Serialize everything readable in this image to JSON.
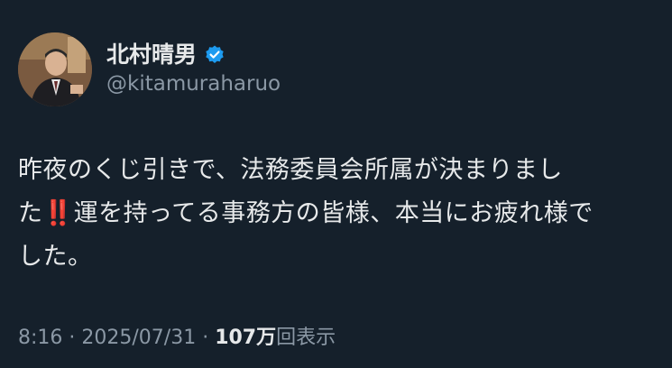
{
  "author": {
    "display_name": "北村晴男",
    "handle": "@kitamuraharuo",
    "avatar_icon": "profile-photo",
    "verified_icon": "verified-badge-icon",
    "verified_color": "#1d9bf0"
  },
  "tweet": {
    "line1": "昨夜のくじ引きで、法務委員会所属が決まりまし",
    "line2_prefix": "た",
    "line2_emoji": "‼️",
    "line2_suffix": "運を持ってる事務方の皆様、本当にお疲れ様で",
    "line3": "した。"
  },
  "meta": {
    "time": "8:16",
    "separator": " · ",
    "date": "2025/07/31",
    "views_count": "107万",
    "views_label": "回表示"
  },
  "colors": {
    "background": "#15202b",
    "text_primary": "#e7e9ea",
    "text_secondary": "#8b98a5"
  }
}
